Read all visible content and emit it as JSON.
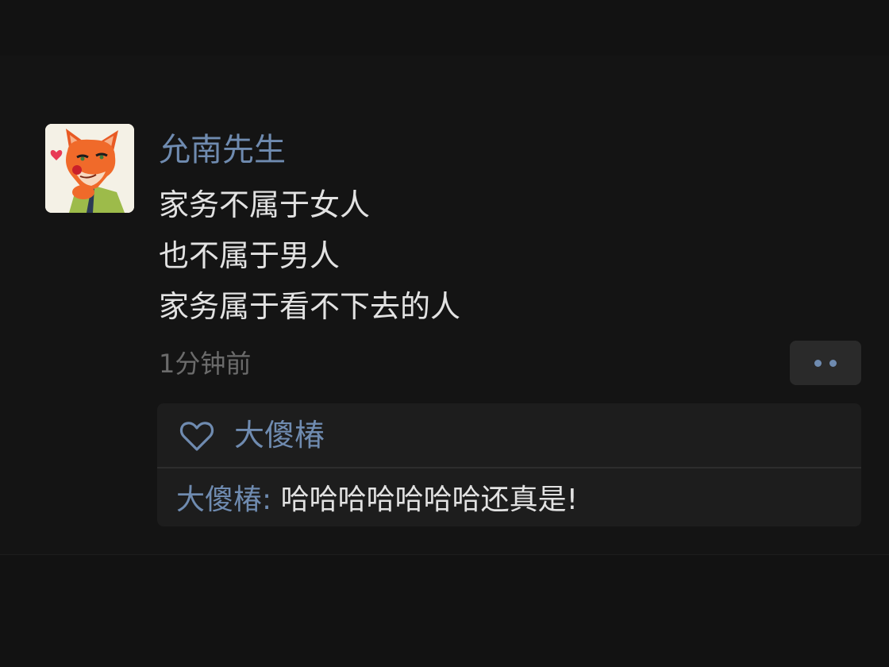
{
  "post": {
    "avatar_icon": "fox-avatar-icon",
    "username": "允南先生",
    "content_lines": [
      "家务不属于女人",
      "也不属于男人",
      "家务属于看不下去的人"
    ],
    "timestamp": "1分钟前",
    "more_icon": "two-dots-more-icon"
  },
  "likes": {
    "icon": "heart-icon",
    "users": "大傻椿"
  },
  "comments": [
    {
      "author": "大傻椿",
      "separator": ": ",
      "text": "哈哈哈哈哈哈哈还真是!"
    }
  ],
  "colors": {
    "background": "#121212",
    "name_link": "#6f8bb0",
    "primary_text": "#e2e2e2",
    "secondary_text": "#6b6b6b",
    "panel": "#1d1d1d"
  }
}
